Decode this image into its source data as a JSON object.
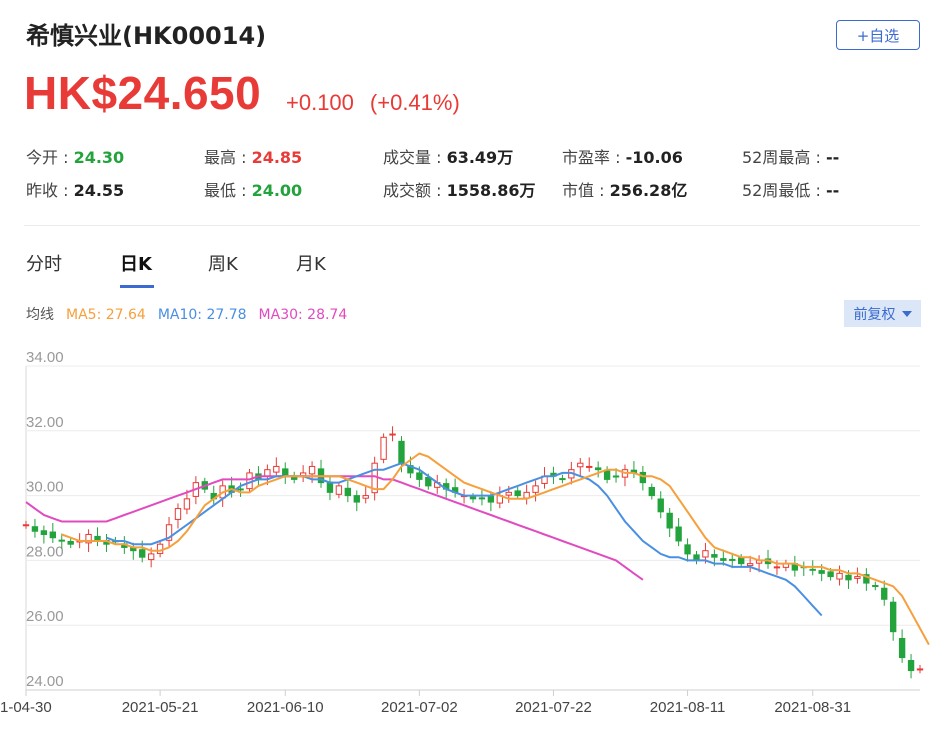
{
  "header": {
    "title": "希慎兴业(HK00014)",
    "add_watchlist_label": "+自选"
  },
  "quote": {
    "price": "HK$24.650",
    "change": "+0.100",
    "change_pct": "(+0.41%)"
  },
  "stats": [
    {
      "label": "今开 : ",
      "value": "24.30",
      "color": "green"
    },
    {
      "label": "最高 : ",
      "value": "24.85",
      "color": "red"
    },
    {
      "label": "成交量 : ",
      "value": "63.49万",
      "color": "plain"
    },
    {
      "label": "市盈率 : ",
      "value": "-10.06",
      "color": "plain"
    },
    {
      "label": "52周最高 : ",
      "value": "--",
      "color": "plain"
    },
    {
      "label": "昨收 : ",
      "value": "24.55",
      "color": "plain"
    },
    {
      "label": "最低 : ",
      "value": "24.00",
      "color": "green"
    },
    {
      "label": "成交额 : ",
      "value": "1558.86万",
      "color": "plain"
    },
    {
      "label": "市值 : ",
      "value": "256.28亿",
      "color": "plain"
    },
    {
      "label": "52周最低 : ",
      "value": "--",
      "color": "plain"
    }
  ],
  "tabs": [
    {
      "label": "分时",
      "active": false
    },
    {
      "label": "日K",
      "active": true
    },
    {
      "label": "周K",
      "active": false
    },
    {
      "label": "月K",
      "active": false
    }
  ],
  "ma_legend": {
    "label": "均线",
    "ma5": "MA5: 27.64",
    "ma10": "MA10: 27.78",
    "ma30": "MA30: 28.74"
  },
  "adjust_button": "前复权",
  "colors": {
    "up": "#e83a36",
    "down": "#23a33c",
    "ma5": "#f5a03c",
    "ma10": "#4a8fe2",
    "ma30": "#e04bc0",
    "accent": "#3b6bd0"
  },
  "chart_data": {
    "type": "candlestick",
    "ylim": [
      24,
      34
    ],
    "y_ticks": [
      "34.00",
      "32.00",
      "30.00",
      "28.00",
      "26.00",
      "24.00"
    ],
    "x_ticks": [
      "1-04-30",
      "2021-05-21",
      "2021-06-10",
      "2021-07-02",
      "2021-07-22",
      "2021-08-11",
      "2021-08-31"
    ],
    "x_tick_index": [
      0,
      15,
      29,
      44,
      59,
      74,
      88
    ],
    "close": [
      29.1,
      28.9,
      28.8,
      28.7,
      28.6,
      28.5,
      28.6,
      28.8,
      28.6,
      28.5,
      28.6,
      28.4,
      28.3,
      28.1,
      28.2,
      28.5,
      29.1,
      29.6,
      29.9,
      30.4,
      30.2,
      29.9,
      30.3,
      30.1,
      30.2,
      30.7,
      30.5,
      30.8,
      30.9,
      30.6,
      30.5,
      30.7,
      30.9,
      30.4,
      30.1,
      30.3,
      30.0,
      29.8,
      30.0,
      31.0,
      31.8,
      31.9,
      31.0,
      30.7,
      30.5,
      30.3,
      30.4,
      30.2,
      30.1,
      30.0,
      29.9,
      29.9,
      29.8,
      30.0,
      30.1,
      30.0,
      30.1,
      30.3,
      30.6,
      30.6,
      30.5,
      30.8,
      31.0,
      30.9,
      30.8,
      30.5,
      30.6,
      30.8,
      30.7,
      30.4,
      30.0,
      29.5,
      29.0,
      28.6,
      28.2,
      28.0,
      28.3,
      28.1,
      28.0,
      28.0,
      27.9,
      27.9,
      28.0,
      27.9,
      27.8,
      27.9,
      27.7,
      27.8,
      27.7,
      27.6,
      27.5,
      27.6,
      27.4,
      27.5,
      27.3,
      27.2,
      26.8,
      25.8,
      25.0,
      24.6,
      24.65
    ],
    "ma5": {
      "name": "MA5",
      "start_index": 4,
      "values": [
        28.8,
        28.7,
        28.6,
        28.6,
        28.6,
        28.6,
        28.5,
        28.5,
        28.4,
        28.4,
        28.3,
        28.3,
        28.4,
        28.6,
        28.9,
        29.3,
        29.7,
        29.9,
        30.1,
        30.2,
        30.1,
        30.1,
        30.3,
        30.4,
        30.5,
        30.6,
        30.6,
        30.6,
        30.6,
        30.6,
        30.6,
        30.6,
        30.5,
        30.4,
        30.3,
        30.2,
        30.2,
        30.5,
        30.9,
        31.1,
        31.3,
        31.2,
        31.0,
        30.8,
        30.6,
        30.4,
        30.3,
        30.2,
        30.1,
        30.0,
        29.9,
        29.9,
        29.9,
        30.0,
        30.1,
        30.2,
        30.3,
        30.4,
        30.5,
        30.6,
        30.7,
        30.8,
        30.8,
        30.7,
        30.7,
        30.6,
        30.6,
        30.5,
        30.3,
        29.9,
        29.5,
        29.1,
        28.7,
        28.4,
        28.3,
        28.2,
        28.1,
        28.1,
        28.0,
        28.0,
        27.9,
        27.9,
        27.9,
        27.8,
        27.8,
        27.8,
        27.7,
        27.7,
        27.6,
        27.6,
        27.5,
        27.4,
        27.3,
        27.2,
        26.9,
        26.4,
        25.9,
        25.4
      ]
    },
    "ma10": {
      "name": "MA10",
      "start_index": 9,
      "values": [
        28.7,
        28.6,
        28.6,
        28.5,
        28.5,
        28.5,
        28.6,
        28.7,
        28.9,
        29.1,
        29.3,
        29.5,
        29.7,
        29.9,
        30.1,
        30.3,
        30.4,
        30.5,
        30.5,
        30.6,
        30.6,
        30.6,
        30.6,
        30.5,
        30.5,
        30.4,
        30.4,
        30.5,
        30.6,
        30.7,
        30.8,
        30.8,
        30.9,
        31.0,
        30.9,
        30.8,
        30.6,
        30.4,
        30.2,
        30.1,
        30.0,
        30.0,
        30.0,
        30.0,
        30.1,
        30.2,
        30.3,
        30.4,
        30.5,
        30.6,
        30.6,
        30.7,
        30.7,
        30.6,
        30.5,
        30.3,
        30.0,
        29.6,
        29.2,
        28.9,
        28.6,
        28.4,
        28.2,
        28.1,
        28.1,
        28.0,
        28.0,
        28.0,
        27.9,
        27.9,
        27.8,
        27.8,
        27.8,
        27.7,
        27.6,
        27.5,
        27.4,
        27.2,
        26.9,
        26.6,
        26.3
      ]
    },
    "ma30": {
      "name": "MA30",
      "start_index": 0,
      "values": [
        29.8,
        29.6,
        29.4,
        29.3,
        29.2,
        29.2,
        29.2,
        29.2,
        29.2,
        29.2,
        29.3,
        29.4,
        29.5,
        29.6,
        29.7,
        29.8,
        29.9,
        30.0,
        30.1,
        30.2,
        30.3,
        30.4,
        30.5,
        30.5,
        30.5,
        30.5,
        30.6,
        30.6,
        30.6,
        30.6,
        30.6,
        30.6,
        30.6,
        30.6,
        30.6,
        30.6,
        30.6,
        30.6,
        30.6,
        30.6,
        30.5,
        30.5,
        30.4,
        30.3,
        30.2,
        30.1,
        30.0,
        29.9,
        29.8,
        29.7,
        29.6,
        29.5,
        29.4,
        29.3,
        29.2,
        29.1,
        29.0,
        28.9,
        28.8,
        28.7,
        28.6,
        28.5,
        28.4,
        28.3,
        28.2,
        28.1,
        28.0,
        27.8,
        27.6,
        27.4
      ]
    }
  }
}
